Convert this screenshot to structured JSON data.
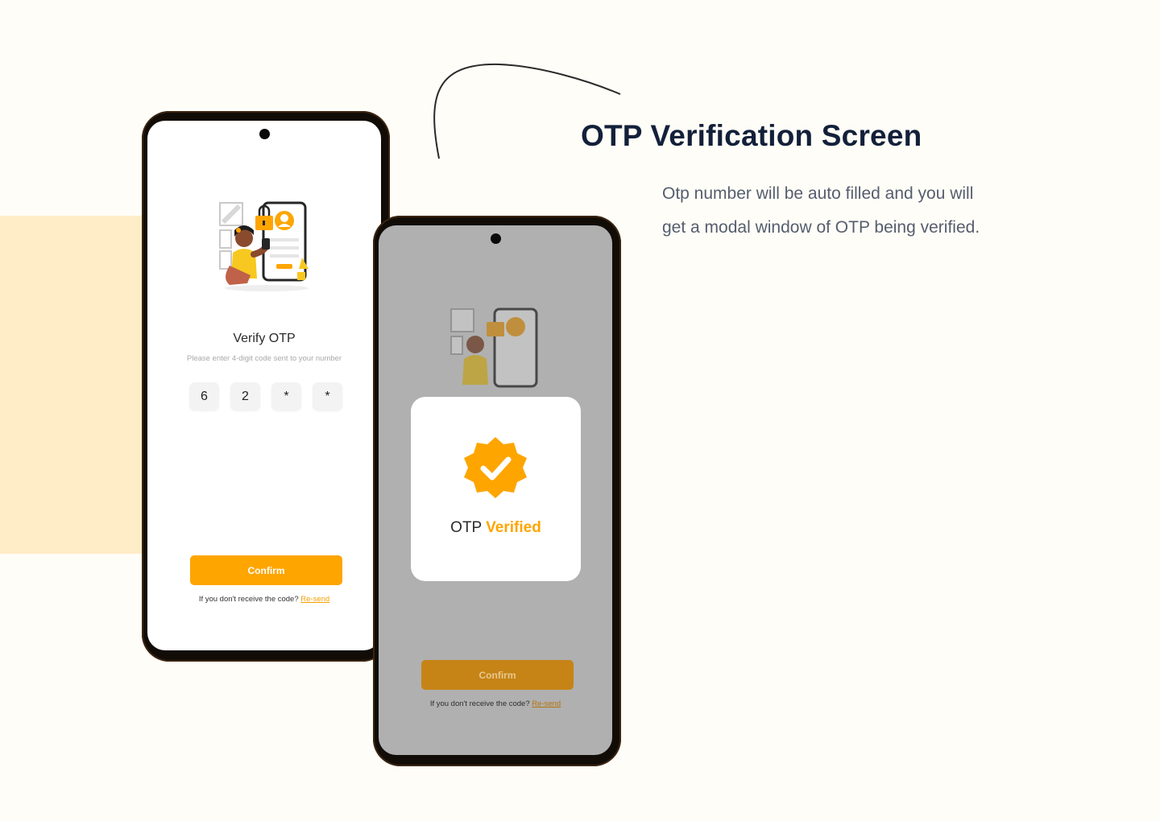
{
  "heading": "OTP Verification Screen",
  "description": "Otp number will be auto filled and you will get a modal window of OTP being verified.",
  "colors": {
    "accent": "#FEA500",
    "heading": "#13203A",
    "background": "#FFFDF7",
    "band": "#FFEDC7"
  },
  "screen_left": {
    "title": "Verify OTP",
    "subtitle": "Please enter 4-digit code sent to your number",
    "otp_digits": [
      "6",
      "2",
      "*",
      "*"
    ],
    "confirm_label": "Confirm",
    "resend_prompt": "If you don't receive the code?",
    "resend_link": "Re-send"
  },
  "screen_right": {
    "modal_prefix": "OTP",
    "modal_highlight": "Verified",
    "confirm_label": "Confirm",
    "resend_prompt": "If you don't receive the code?",
    "resend_link": "Re-send"
  },
  "icons": [
    "verified-badge-icon",
    "lock-icon",
    "profile-icon"
  ]
}
